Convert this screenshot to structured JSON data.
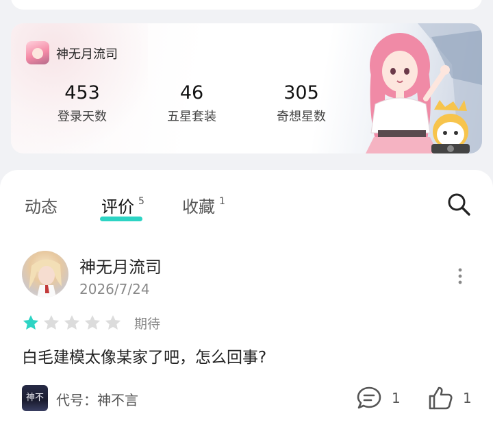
{
  "game": {
    "name": "神无月流司",
    "stats": [
      {
        "value": "453",
        "label": "登录天数"
      },
      {
        "value": "46",
        "label": "五星套装"
      },
      {
        "value": "305",
        "label": "奇想星数"
      }
    ]
  },
  "tabs": [
    {
      "label": "动态",
      "count": ""
    },
    {
      "label": "评价",
      "count": "5"
    },
    {
      "label": "收藏",
      "count": "1"
    }
  ],
  "review": {
    "username": "神无月流司",
    "date": "2026/7/24",
    "rating": 1,
    "rating_max": 5,
    "rating_label": "期待",
    "text": "白毛建模太像某家了吧，怎么回事?",
    "source_icon_text": "神不言",
    "source_name": "代号：神不言",
    "comment_count": "1",
    "like_count": "1"
  },
  "colors": {
    "accent": "#2dd4c4",
    "star_filled": "#2dd4c4",
    "star_empty": "#dcdcdc"
  }
}
